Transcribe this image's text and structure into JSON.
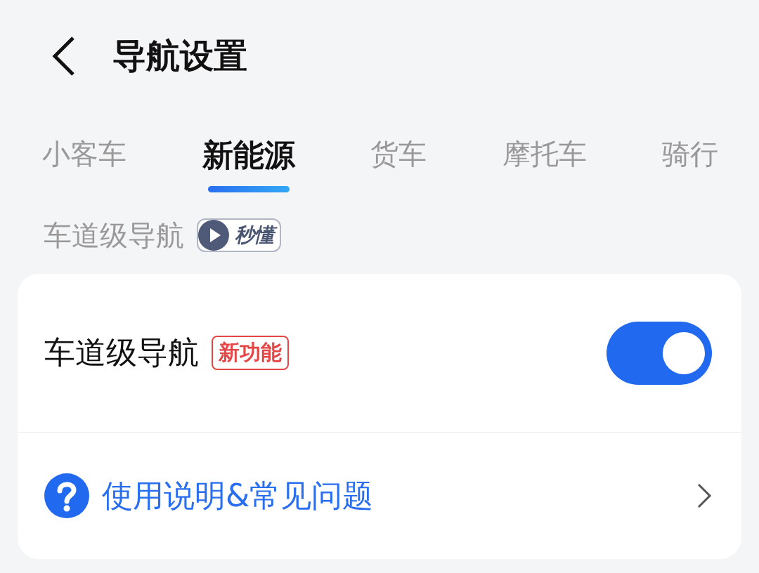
{
  "header": {
    "title": "导航设置"
  },
  "tabs": [
    {
      "label": "小客车",
      "selected": false
    },
    {
      "label": "新能源",
      "selected": true
    },
    {
      "label": "货车",
      "selected": false
    },
    {
      "label": "摩托车",
      "selected": false
    },
    {
      "label": "骑行",
      "selected": false
    }
  ],
  "section": {
    "title": "车道级导航",
    "badge": "秒懂"
  },
  "settings": [
    {
      "kind": "toggle",
      "label": "车道级导航",
      "tag": "新功能",
      "on": true
    },
    {
      "kind": "link",
      "label": "使用说明&常见问题"
    }
  ]
}
